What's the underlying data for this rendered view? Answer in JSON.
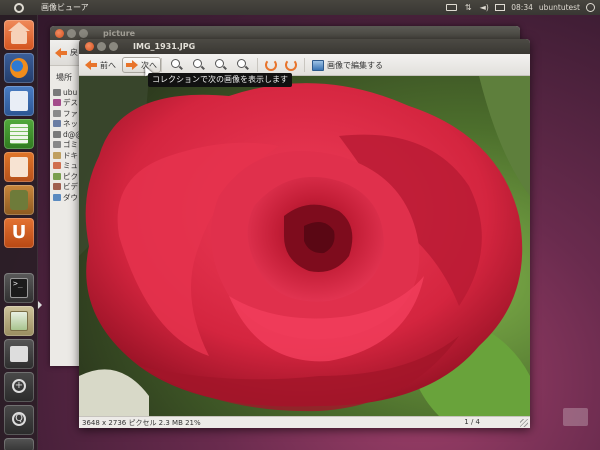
{
  "panel": {
    "app_name": "画像ビューア",
    "clock": "08:34",
    "user": "ubuntutest"
  },
  "launcher": {
    "items": [
      {
        "name": "home-folder",
        "icon": "home-folder-icon"
      },
      {
        "name": "firefox",
        "icon": "firefox-icon"
      },
      {
        "name": "writer",
        "icon": "libreoffice-writer-icon"
      },
      {
        "name": "calc",
        "icon": "libreoffice-calc-icon"
      },
      {
        "name": "impress",
        "icon": "libreoffice-impress-icon"
      },
      {
        "name": "software-center",
        "icon": "software-center-icon"
      },
      {
        "name": "ubuntu-one",
        "icon": "ubuntu-one-icon",
        "glyph": "U"
      },
      {
        "name": "terminal",
        "icon": "terminal-icon",
        "glyph": ">_"
      },
      {
        "name": "image-viewer",
        "icon": "image-viewer-icon"
      },
      {
        "name": "workspace-switcher",
        "icon": "workspace-icon"
      },
      {
        "name": "zoom-in",
        "icon": "zoom-in-icon",
        "glyph": "+"
      },
      {
        "name": "zoom-out",
        "icon": "zoom-out-icon",
        "glyph": "Q"
      },
      {
        "name": "trash",
        "icon": "trash-icon"
      }
    ]
  },
  "file_manager": {
    "title": "picture",
    "back_label": "戻",
    "places_header": "場所",
    "places": [
      "ubu",
      "デス",
      "ファ",
      "ネッ",
      "d@@",
      "ゴミ",
      "ドキ",
      "ミュ",
      "ピク",
      "ビデ",
      "ダウ"
    ],
    "place_colors": [
      "#7a7a7a",
      "#a34b8a",
      "#8a8a8a",
      "#6a7da3",
      "#7a7a7a",
      "#888888",
      "#c0a060",
      "#d07050",
      "#7aa050",
      "#a06050",
      "#5a8ac0"
    ]
  },
  "viewer": {
    "title": "IMG_1931.JPG",
    "toolbar": {
      "prev_label": "前へ",
      "next_label": "次へ",
      "edit_label": "画像で編集する"
    },
    "tooltip": "コレクションで次の画像を表示します",
    "status": {
      "info": "3648 x 2736 ピクセル  2.3 MB   21%",
      "page": "1 / 4"
    }
  },
  "colors": {
    "accent_orange": "#e8742b",
    "rose_red": "#d4253f",
    "panel_bg": "#3c3b37"
  }
}
